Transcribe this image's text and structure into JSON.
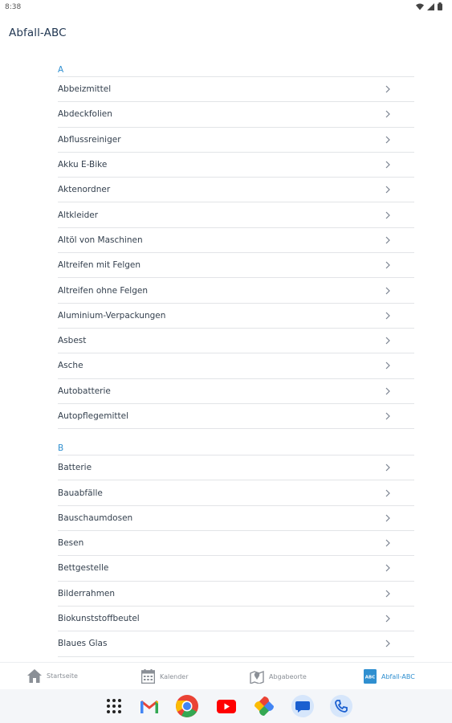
{
  "status_bar": {
    "time": "8:38"
  },
  "app_title": "Abfall-ABC",
  "sections": [
    {
      "letter": "A",
      "items": [
        "Abbeizmittel",
        "Abdeckfolien",
        "Abflussreiniger",
        "Akku E-Bike",
        "Aktenordner",
        "Altkleider",
        "Altöl von Maschinen",
        "Altreifen mit Felgen",
        "Altreifen ohne Felgen",
        "Aluminium-Verpackungen",
        "Asbest",
        "Asche",
        "Autobatterie",
        "Autopflegemittel"
      ]
    },
    {
      "letter": "B",
      "items": [
        "Batterie",
        "Bauabfälle",
        "Bauschaumdosen",
        "Besen",
        "Bettgestelle",
        "Bilderrahmen",
        "Biokunststoffbeutel",
        "Blaues Glas"
      ]
    }
  ],
  "bottom_nav": {
    "home": "Startseite",
    "calendar": "Kalender",
    "dropoff": "Abgabeorte",
    "abc": "Abfall-ABC",
    "active_color": "#2f8fd0"
  },
  "dock_apps": [
    "apps-grid-icon",
    "gmail-icon",
    "chrome-icon",
    "youtube-icon",
    "photos-icon",
    "messages-icon",
    "phone-icon"
  ]
}
